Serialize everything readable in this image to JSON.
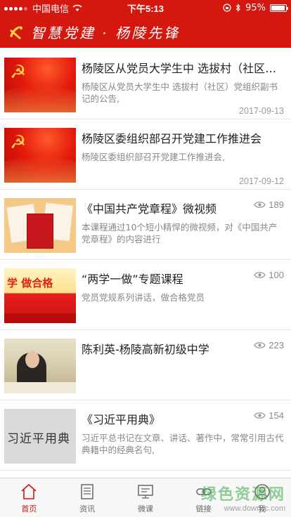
{
  "status_bar": {
    "carrier": "中国电信",
    "time": "下午5:13",
    "battery": "95%",
    "battery_level": 0.95
  },
  "header": {
    "slogan": "智慧党建 · 杨陵先锋"
  },
  "colors": {
    "brand_red": "#d4170f",
    "active_tab": "#d4170f"
  },
  "feed": [
    {
      "title": "杨陵区从党员大学生中 选拔村（社区）党组织副书记的公告",
      "desc": "杨陵区从党员大学生中 选拔村（社区）党组织副书记的公告,",
      "date": "2017-09-13",
      "thumb": "party-flag"
    },
    {
      "title": "杨陵区委组织部召开党建工作推进会",
      "desc": "杨陵区委组织部召开党建工作推进会,",
      "date": "2017-09-12",
      "thumb": "party-flag"
    },
    {
      "title": "《中国共产党章程》微视频",
      "desc": "本课程通过10个短小精悍的微视频，对《中国共产党章程》的内容进行",
      "views": "189",
      "thumb": "party-constitution-book"
    },
    {
      "title": "“两学一做”专题课程",
      "desc": "党员党规系列讲话，做合格党员",
      "views": "100",
      "thumb": "two-studies-banner"
    },
    {
      "title": "陈利英-杨陵高新初级中学",
      "desc": "",
      "views": "223",
      "thumb": "meeting-photo"
    },
    {
      "title": "《习近平用典》",
      "desc": "习近平总书记在文章、讲话、著作中，常常引用古代典籍中的经典名句,",
      "views": "154",
      "thumb": "book-cover",
      "thumb_text": "习近平用典"
    }
  ],
  "tabs": [
    {
      "label": "首页",
      "icon": "home-icon",
      "active": true
    },
    {
      "label": "资讯",
      "icon": "news-icon",
      "active": false
    },
    {
      "label": "微课",
      "icon": "course-icon",
      "active": false
    },
    {
      "label": "链接",
      "icon": "link-icon",
      "active": false
    },
    {
      "label": "我",
      "icon": "user-icon",
      "active": false
    }
  ],
  "watermark": {
    "line1": "绿色资源网",
    "line2": "www.downcc.com"
  }
}
